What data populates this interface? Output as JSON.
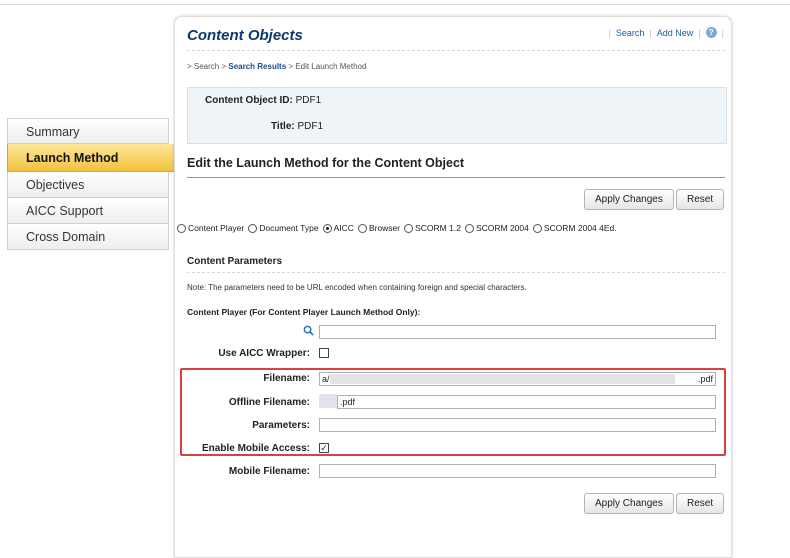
{
  "header": {
    "title": "Content Objects",
    "links": [
      "Search",
      "Add New"
    ]
  },
  "breadcrumb": {
    "prefix": "> Search > ",
    "current": "Search Results",
    "suffix": " > Edit Launch Method"
  },
  "sidebar": {
    "items": [
      {
        "label": "Summary"
      },
      {
        "label": "Launch Method"
      },
      {
        "label": "Objectives"
      },
      {
        "label": "AICC Support"
      },
      {
        "label": "Cross Domain"
      }
    ]
  },
  "info": {
    "id_label": "Content Object ID:",
    "id_value": "PDF1",
    "title_label": "Title:",
    "title_value": "PDF1"
  },
  "section": {
    "title": "Edit the Launch Method for the Content Object",
    "apply_label": "Apply Changes",
    "reset_label": "Reset"
  },
  "launch_methods": {
    "options": [
      "Content Player",
      "Document Type",
      "AICC",
      "Browser",
      "SCORM 1.2",
      "SCORM 2004",
      "SCORM 2004 4Ed."
    ],
    "selected": "AICC"
  },
  "params": {
    "title": "Content Parameters",
    "note": "Note: The parameters need to be URL encoded when containing foreign and special characters.",
    "content_player_label": "Content Player (For Content Player Launch Method Only):",
    "content_player_value": "",
    "use_aicc_label": "Use AICC Wrapper:",
    "use_aicc_checked": false,
    "filename_label": "Filename:",
    "filename_value_start": "a/",
    "filename_value_end": ".pdf",
    "offline_label": "Offline Filename:",
    "offline_value": ".pdf",
    "parameters_label": "Parameters:",
    "parameters_value": "",
    "mobile_access_label": "Enable Mobile Access:",
    "mobile_access_checked": true,
    "mobile_filename_label": "Mobile Filename:",
    "mobile_filename_value": ""
  },
  "colors": {
    "accent_title": "#0b3a6b",
    "active_tab": "#f3c23c",
    "highlight": "#d94040",
    "link": "#1f5aa6"
  }
}
